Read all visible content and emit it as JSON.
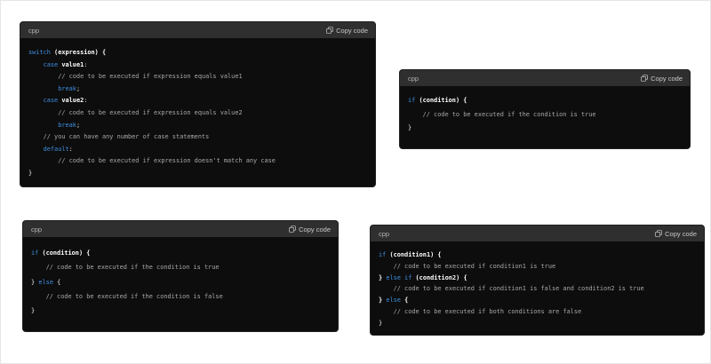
{
  "copy_label": "Copy code",
  "cards": [
    {
      "lang": "cpp",
      "lines": [
        [
          [
            "kw",
            "switch "
          ],
          [
            "fn",
            "(expression) {"
          ]
        ],
        [
          [
            "pl",
            "    "
          ],
          [
            "kw",
            "case "
          ],
          [
            "fn",
            "value1"
          ],
          [
            "pl",
            ":"
          ]
        ],
        [
          [
            "cm",
            "        // code to be executed if expression equals value1"
          ]
        ],
        [
          [
            "pl",
            "        "
          ],
          [
            "kw",
            "break"
          ],
          [
            "pl",
            ";"
          ]
        ],
        [
          [
            "pl",
            "    "
          ],
          [
            "kw",
            "case "
          ],
          [
            "fn",
            "value2"
          ],
          [
            "pl",
            ":"
          ]
        ],
        [
          [
            "cm",
            "        // code to be executed if expression equals value2"
          ]
        ],
        [
          [
            "pl",
            "        "
          ],
          [
            "kw",
            "break"
          ],
          [
            "pl",
            ";"
          ]
        ],
        [
          [
            "cm",
            "    // you can have any number of case statements"
          ]
        ],
        [
          [
            "pl",
            "    "
          ],
          [
            "kw",
            "default"
          ],
          [
            "pl",
            ":"
          ]
        ],
        [
          [
            "cm",
            "        // code to be executed if expression doesn't match any case"
          ]
        ],
        [
          [
            "pl",
            "}"
          ]
        ]
      ]
    },
    {
      "lang": "cpp",
      "lines": [
        [
          [
            "kw",
            "if "
          ],
          [
            "fn",
            "(condition) {"
          ]
        ],
        [
          [
            "cm",
            "    // code to be executed if the condition is true"
          ]
        ],
        [
          [
            "pl",
            "}"
          ]
        ]
      ]
    },
    {
      "lang": "cpp",
      "lines": [
        [
          [
            "kw",
            "if "
          ],
          [
            "fn",
            "(condition) {"
          ]
        ],
        [
          [
            "cm",
            "    // code to be executed if the condition is true"
          ]
        ],
        [
          [
            "pl",
            "} "
          ],
          [
            "kw",
            "else "
          ],
          [
            "pl",
            "{"
          ]
        ],
        [
          [
            "cm",
            "    // code to be executed if the condition is false"
          ]
        ],
        [
          [
            "pl",
            "}"
          ]
        ]
      ]
    },
    {
      "lang": "cpp",
      "lines": [
        [
          [
            "kw",
            "if "
          ],
          [
            "fn",
            "(condition1) {"
          ]
        ],
        [
          [
            "cm",
            "    // code to be executed if condition1 is true"
          ]
        ],
        [
          [
            "fn",
            "} "
          ],
          [
            "kw",
            "else if "
          ],
          [
            "fn",
            "(condition2) {"
          ]
        ],
        [
          [
            "cm",
            "    // code to be executed if condition1 is false and condition2 is true"
          ]
        ],
        [
          [
            "fn",
            "} "
          ],
          [
            "kw",
            "else "
          ],
          [
            "fn",
            "{"
          ]
        ],
        [
          [
            "cm",
            "    // code to be executed if both conditions are false"
          ]
        ],
        [
          [
            "pl",
            "}"
          ]
        ]
      ]
    }
  ]
}
